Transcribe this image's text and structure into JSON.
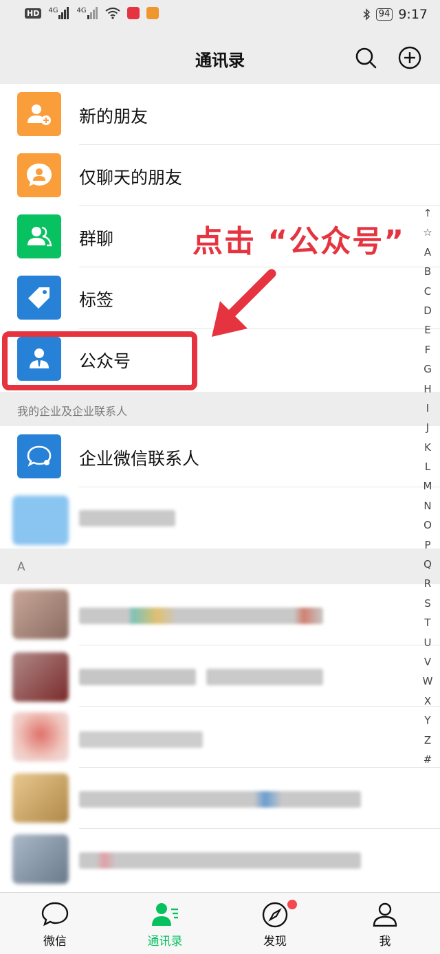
{
  "status_bar": {
    "left_icons": [
      "hd-icon",
      "signal-4g-icon",
      "signal-4g-icon",
      "wifi-icon",
      "app-icon-red",
      "app-icon-orange"
    ],
    "hd_label": "HD",
    "net_label_1": "4G",
    "net_label_2": "4G",
    "battery": "94",
    "time": "9:17"
  },
  "header": {
    "title": "通讯录",
    "search_icon": "search-icon",
    "add_icon": "plus-circle-icon"
  },
  "menu_items": [
    {
      "label": "新的朋友",
      "icon": "add-friend-icon",
      "color": "#fa9d3b"
    },
    {
      "label": "仅聊天的朋友",
      "icon": "chat-only-icon",
      "color": "#fa9d3b"
    },
    {
      "label": "群聊",
      "icon": "group-chat-icon",
      "color": "#08c160"
    },
    {
      "label": "标签",
      "icon": "tag-icon",
      "color": "#2782d7"
    },
    {
      "label": "公众号",
      "icon": "official-account-icon",
      "color": "#2782d7"
    }
  ],
  "enterprise_section": {
    "header": "我的企业及企业联系人",
    "item_label": "企业微信联系人",
    "item_icon": "enterprise-contact-icon",
    "item_color": "#2782d7"
  },
  "contacts_section": {
    "letter": "A"
  },
  "index_letters": [
    "↑",
    "☆",
    "A",
    "B",
    "C",
    "D",
    "E",
    "F",
    "G",
    "H",
    "I",
    "J",
    "K",
    "L",
    "M",
    "N",
    "O",
    "P",
    "Q",
    "R",
    "S",
    "T",
    "U",
    "V",
    "W",
    "X",
    "Y",
    "Z",
    "#"
  ],
  "annotation": {
    "text": "点击 “公众号”",
    "color": "#e5343f"
  },
  "tab_bar": {
    "tabs": [
      {
        "label": "微信",
        "icon": "chat-bubble-icon",
        "active": false
      },
      {
        "label": "通讯录",
        "icon": "contacts-icon",
        "active": true
      },
      {
        "label": "发现",
        "icon": "compass-icon",
        "active": false,
        "badge": "red-dot"
      },
      {
        "label": "我",
        "icon": "person-icon",
        "active": false
      }
    ],
    "active_color": "#07c160"
  }
}
